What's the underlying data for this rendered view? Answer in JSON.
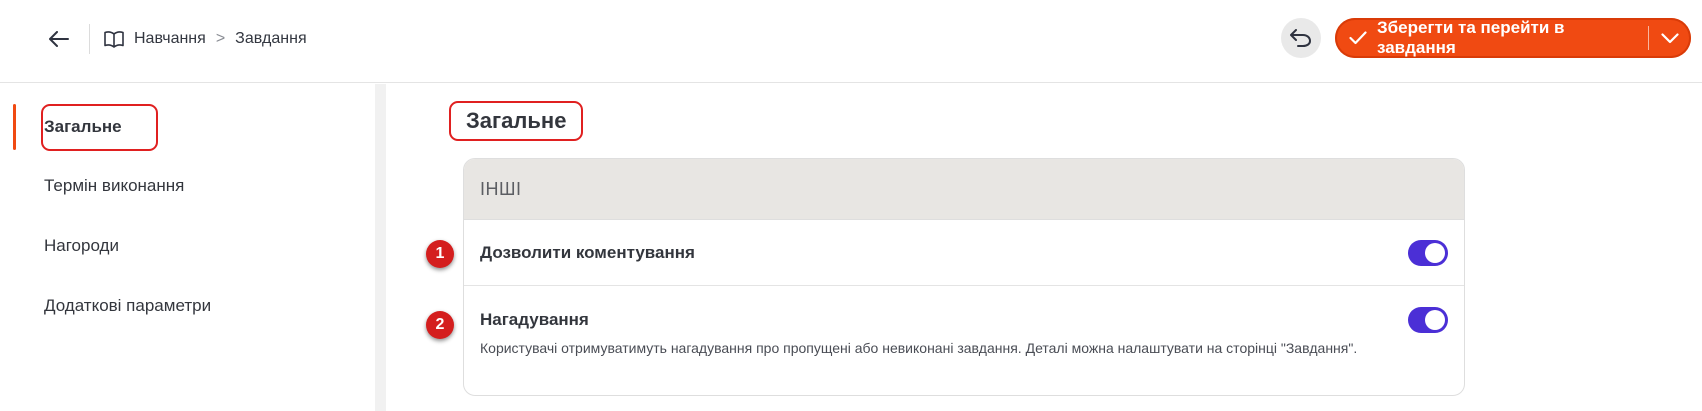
{
  "header": {
    "breadcrumb": [
      "Навчання",
      "Завдання"
    ],
    "breadcrumb_separator": ">",
    "save_label": "Зберегти та перейти в завдання",
    "accent_color": "#f04a12"
  },
  "sidebar": {
    "items": [
      {
        "label": "Загальне",
        "active": true
      },
      {
        "label": "Термін виконання",
        "active": false
      },
      {
        "label": "Нагороди",
        "active": false
      },
      {
        "label": "Додаткові параметри",
        "active": false
      }
    ]
  },
  "main": {
    "title": "Загальне",
    "card": {
      "header": "ІНШІ",
      "settings": [
        {
          "label": "Дозволити коментування",
          "enabled": true
        },
        {
          "label": "Нагадування",
          "enabled": true,
          "description": "Користувачі отримуватимуть нагадування про пропущені або невиконані завдання. Деталі можна налаштувати на сторінці \"Завдання\"."
        }
      ]
    }
  },
  "markers": [
    "1",
    "2"
  ],
  "toggle_color": "#4b2fd6",
  "highlight_color": "#e02020"
}
